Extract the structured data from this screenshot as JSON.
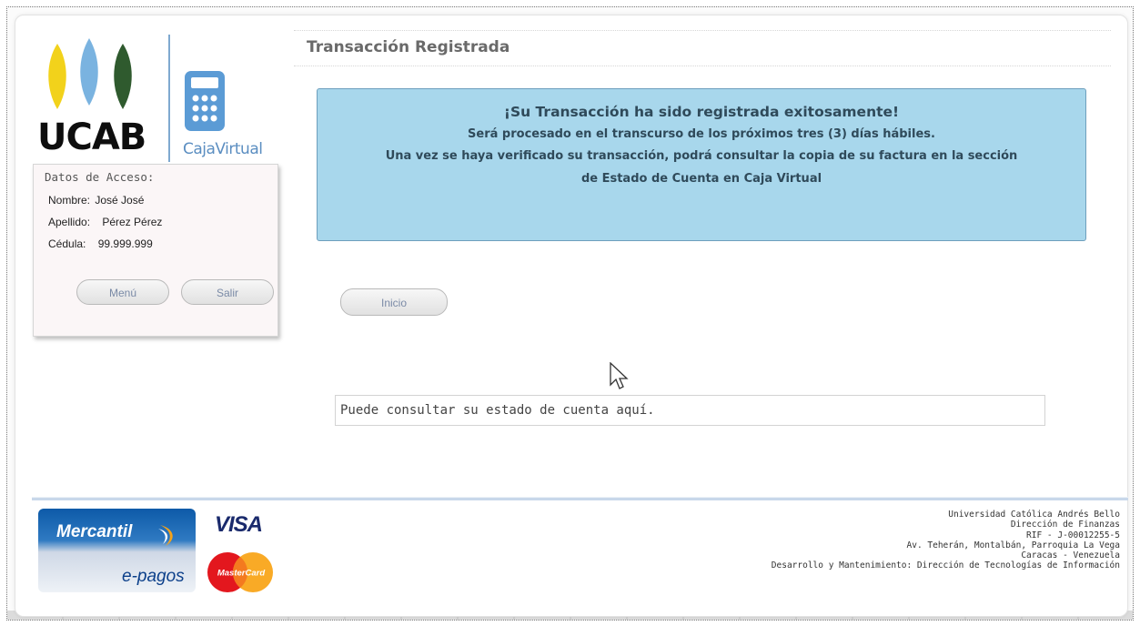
{
  "logo": {
    "text": "UCAB",
    "subtitle": "CajaVirtual"
  },
  "access": {
    "title": "Datos de Acceso:",
    "rows": [
      {
        "label": "Nombre:",
        "value": "José José"
      },
      {
        "label": "Apellido:",
        "value": "Pérez Pérez"
      },
      {
        "label": "Cédula:",
        "value": "99.999.999"
      }
    ],
    "menu_button": "Menú",
    "logout_button": "Salir"
  },
  "heading": "Transacción Registrada",
  "message": {
    "title": "¡Su Transacción ha sido registrada exitosamente!",
    "line1": "Será procesado en el transcurso de los próximos tres (3) días hábiles.",
    "line2": "Una vez se haya verificado su transacción, podrá consultar la copia de su factura en la sección",
    "line3": "de Estado de Cuenta en Caja Virtual"
  },
  "home_button": "Inicio",
  "account_info": "Puede consultar su estado de cuenta aquí.",
  "payments": {
    "bank": "Mercantil",
    "service": "e-pagos",
    "visa": "VISA",
    "mastercard": "MasterCard"
  },
  "footer": {
    "lines": [
      "Universidad Católica Andrés Bello",
      "Dirección de Finanzas",
      "RIF - J-00012255-5",
      "Av. Teherán, Montalbán, Parroquia La Vega",
      "Caracas - Venezuela",
      "Desarrollo y Mantenimiento: Dirección de Tecnologías de Información"
    ]
  },
  "colors": {
    "message_bg": "#a8d7ec",
    "logo_yellow": "#f2d21b",
    "logo_blue": "#7ab3e0",
    "logo_green": "#2f5a2e",
    "caja_blue": "#5b8ec1"
  }
}
